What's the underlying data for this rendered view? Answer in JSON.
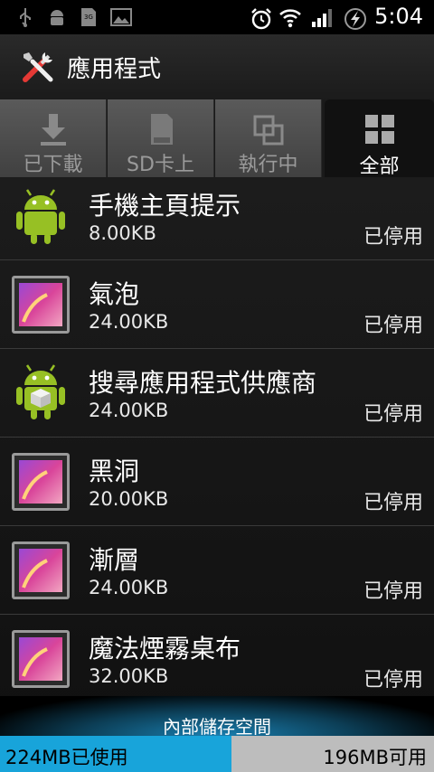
{
  "status_bar": {
    "time": "5:04",
    "left_icons": [
      "usb-icon",
      "android-debug-icon",
      "sd-card-icon",
      "image-icon"
    ],
    "right_icons": [
      "alarm-icon",
      "wifi-icon",
      "signal-icon",
      "battery-charging-icon"
    ]
  },
  "title_bar": {
    "title": "應用程式",
    "icon": "tools-icon"
  },
  "tabs": [
    {
      "label": "已下載",
      "icon": "download-icon",
      "active": false
    },
    {
      "label": "SD卡上",
      "icon": "sd-card-icon",
      "active": false
    },
    {
      "label": "執行中",
      "icon": "running-icon",
      "active": false
    },
    {
      "label": "全部",
      "icon": "grid-icon",
      "active": true
    }
  ],
  "apps": [
    {
      "name": "手機主頁提示",
      "size": "8.00KB",
      "status": "已停用",
      "icon": "android-robot-icon"
    },
    {
      "name": "氣泡",
      "size": "24.00KB",
      "status": "已停用",
      "icon": "wallpaper-icon"
    },
    {
      "name": "搜尋應用程式供應商",
      "size": "24.00KB",
      "status": "已停用",
      "icon": "android-box-icon"
    },
    {
      "name": "黑洞",
      "size": "20.00KB",
      "status": "已停用",
      "icon": "wallpaper-icon"
    },
    {
      "name": "漸層",
      "size": "24.00KB",
      "status": "已停用",
      "icon": "wallpaper-icon"
    },
    {
      "name": "魔法煙霧桌布",
      "size": "32.00KB",
      "status": "已停用",
      "icon": "wallpaper-icon"
    }
  ],
  "storage": {
    "title": "內部儲存空間",
    "used_label": "224MB已使用",
    "free_label": "196MB可用",
    "used_fraction": 0.533
  },
  "colors": {
    "accent": "#18a4da",
    "android_green": "#97c024"
  }
}
